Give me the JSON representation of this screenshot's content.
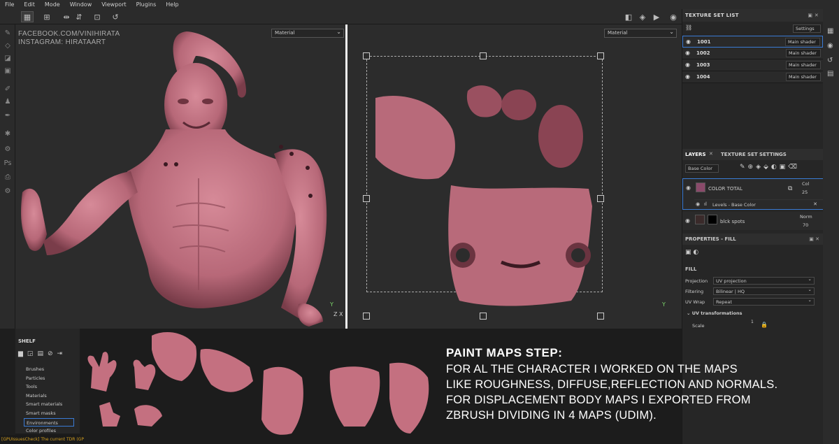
{
  "menu": [
    "File",
    "Edit",
    "Mode",
    "Window",
    "Viewport",
    "Plugins",
    "Help"
  ],
  "watermark": {
    "line1": "FACEBOOK.COM/VINIHIRATA",
    "line2": "INSTAGRAM: HIRATAART"
  },
  "viewport": {
    "left_mode": "Material",
    "right_mode": "Material"
  },
  "axes": {
    "y": "Y",
    "z": "Z",
    "x": "X"
  },
  "texture_set_list": {
    "title": "TEXTURE SET LIST",
    "settings": "Settings",
    "sets": [
      {
        "name": "1001",
        "shader": "Main shader"
      },
      {
        "name": "1002",
        "shader": "Main shader"
      },
      {
        "name": "1003",
        "shader": "Main shader"
      },
      {
        "name": "1004",
        "shader": "Main shader"
      }
    ]
  },
  "layers": {
    "tab_layers": "LAYERS",
    "tab_settings": "TEXTURE SET SETTINGS",
    "channel": "Base Color",
    "items": [
      {
        "name": "COLOR TOTAL",
        "blend": "Col",
        "opacity": "25"
      },
      {
        "name": "Levels - Base Color"
      },
      {
        "name": "blck spots",
        "blend": "Norm",
        "opacity": "70"
      }
    ]
  },
  "properties": {
    "title": "PROPERTIES - FILL",
    "section": "FILL",
    "rows": [
      {
        "label": "Projection",
        "value": "UV projection"
      },
      {
        "label": "Filtering",
        "value": "Bilinear | HQ"
      },
      {
        "label": "UV Wrap",
        "value": "Repeat"
      }
    ],
    "uv_transformations": "UV transformations",
    "scale_label": "Scale",
    "scale_value": "1"
  },
  "shelf": {
    "title": "SHELF",
    "items": [
      "Brushes",
      "Particles",
      "Tools",
      "Materials",
      "Smart materials",
      "Smart masks",
      "Environments",
      "Color profiles"
    ],
    "selected": "Environments"
  },
  "status": "[GPUIssuesCheck] The current TDR (GP",
  "caption": {
    "heading": "PAINT MAPS STEP:",
    "lines": [
      "FOR AL THE CHARACTER I WORKED ON THE MAPS",
      "LIKE ROUGHNESS, DIFFUSE,REFLECTION AND NORMALS.",
      "FOR DISPLACEMENT BODY MAPS I EXPORTED FROM",
      "ZBRUSH DIVIDING IN 4 MAPS (UDIM)."
    ]
  },
  "colors": {
    "accent": "#3a7bd5",
    "skin": "#c87a8a",
    "skin_dark": "#7a3d4a"
  }
}
